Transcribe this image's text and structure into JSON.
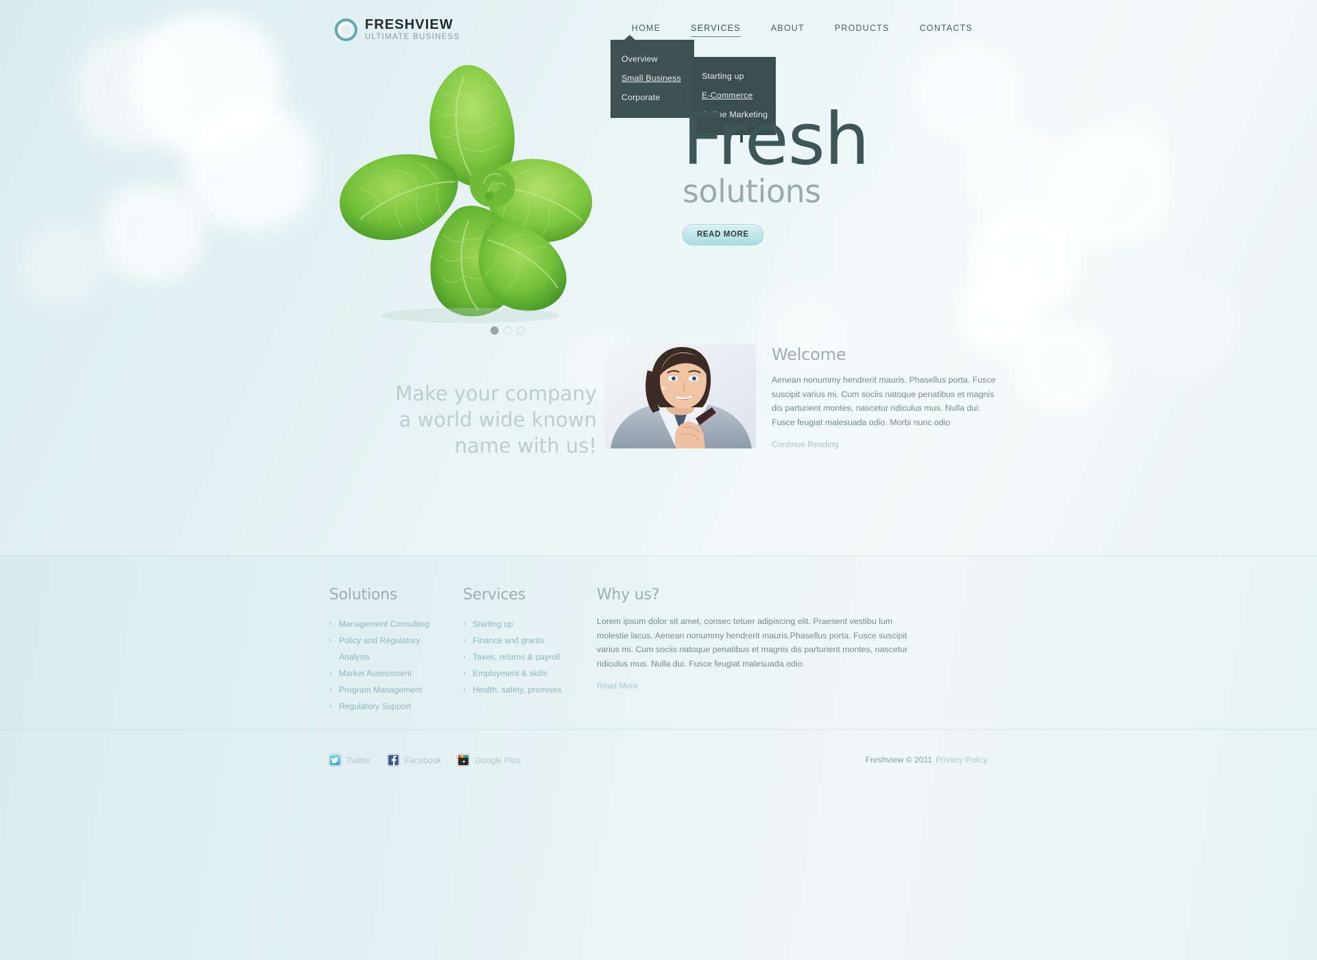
{
  "brand": {
    "name": "FRESHVIEW",
    "tagline": "ULTIMATE BUSINESS",
    "logo_icon": "circle-swirl-icon",
    "accent": "#4f9aa3"
  },
  "nav": {
    "items": [
      {
        "label": "HOME",
        "active": false
      },
      {
        "label": "SERVICES",
        "active": true
      },
      {
        "label": "ABOUT",
        "active": false
      },
      {
        "label": "PRODUCTS",
        "active": false
      },
      {
        "label": "CONTACTS",
        "active": false
      }
    ]
  },
  "dropdown_services": {
    "items": [
      {
        "label": "Overview",
        "selected": false
      },
      {
        "label": "Small Business",
        "selected": true
      },
      {
        "label": "Corporate",
        "selected": false
      }
    ],
    "bg": "#3f5252"
  },
  "dropdown_small_business": {
    "items": [
      {
        "label": "Starting up",
        "selected": false
      },
      {
        "label": "E-Commerce",
        "selected": true
      },
      {
        "label": "Online Marketing",
        "selected": false
      }
    ],
    "bg": "#3b4e4e"
  },
  "hero": {
    "headline": "Fresh",
    "subheadline": "solutions",
    "button_label": "READ MORE",
    "image_alt": "mint-leaves-photo",
    "slides": 3,
    "active_slide": 1
  },
  "slogan": {
    "line1": "Make your company",
    "line2": "a world wide known",
    "line3": "name with us!"
  },
  "welcome": {
    "title": "Welcome",
    "photo_alt": "businesswoman-portrait",
    "body": "Aenean nonummy hendrerit mauris. Phasellus porta. Fusce suscipit varius mi. Cum sociis natoque penatibus et magnis dis parturient montes, nascetur ridiculus mus. Nulla dui. Fusce feugiat malesuada odio. Morbi nunc odio",
    "link": "Continue Reading"
  },
  "footer": {
    "solutions": {
      "title": "Solutions",
      "items": [
        "Management Consulting",
        "Policy and Regulatory Analysis",
        "Market Assessment",
        "Program Management",
        "Regulatory Support"
      ]
    },
    "services": {
      "title": "Services",
      "items": [
        "Starting up",
        "Finance and grants",
        "Taxes, returns & payroll",
        "Employment & skills",
        "Health, safety, premises"
      ]
    },
    "why_us": {
      "title": "Why us?",
      "body": "Lorem ipsum dolor sit amet, consec tetuer adipiscing elit. Praesent vestibu lum molestie lacus. Aenean nonummy hendrerit mauris.Phasellus porta. Fusce suscipit varius mi. Cum sociis natoque penatibus et magnis dis parturient montes, nascetur ridiculus mus. Nulla dui. Fusce feugiat malesuada odio.",
      "link": "Read More"
    },
    "social": [
      {
        "label": "Twitter",
        "icon": "twitter-icon",
        "color": "#55bde8"
      },
      {
        "label": "Facebook",
        "icon": "facebook-icon",
        "color": "#3b5998"
      },
      {
        "label": "Google Plus",
        "icon": "google-plus-icon",
        "color": "#2b2b2b"
      }
    ],
    "copyright": "Freshview © 2011",
    "privacy": "Privacy Policy"
  },
  "chevron": "›"
}
